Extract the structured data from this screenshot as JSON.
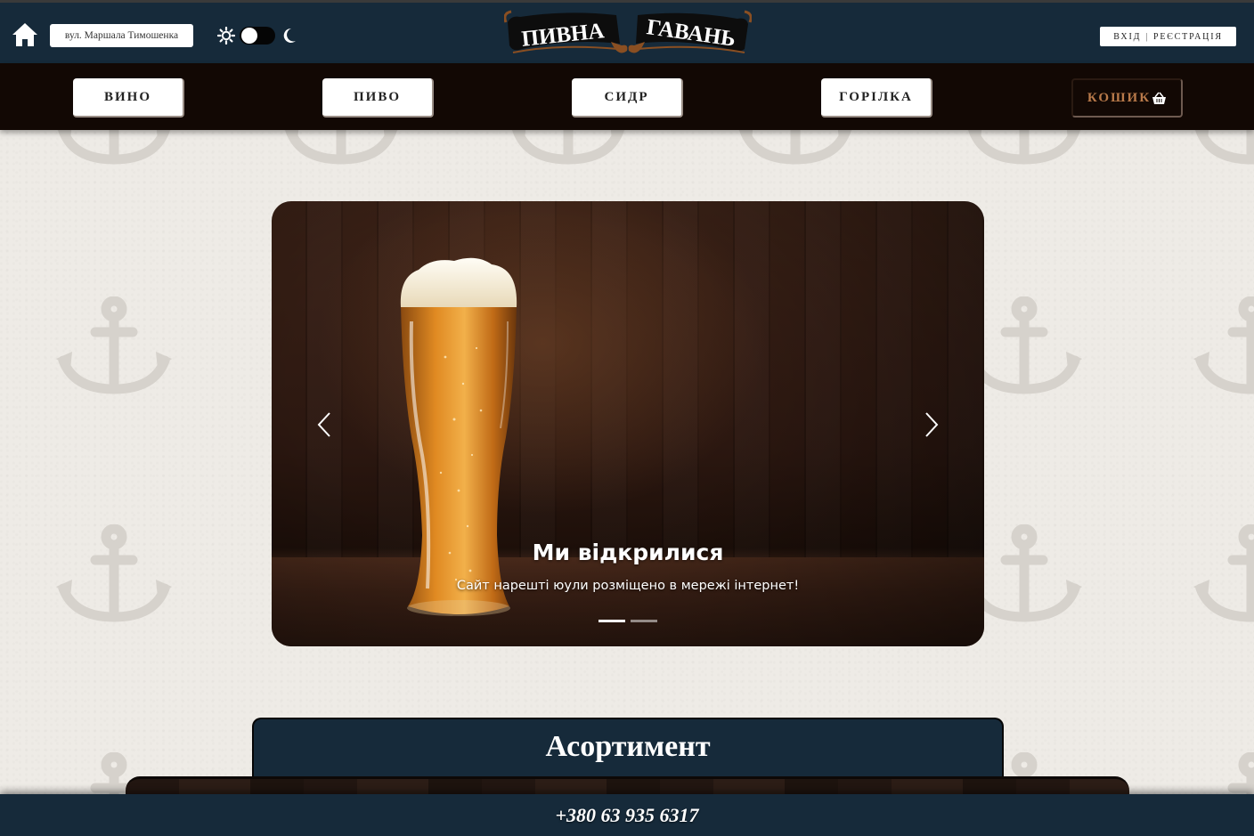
{
  "header": {
    "address": "вул. Маршала Тимошенка",
    "logo": {
      "word1": "ПИВНА",
      "word2": "ГАВАНЬ"
    },
    "auth": {
      "login": "ВХІД",
      "separator": "|",
      "register": "РЕЄСТРАЦІЯ"
    }
  },
  "nav": {
    "items": [
      {
        "label": "ВИНО"
      },
      {
        "label": "ПИВО"
      },
      {
        "label": "СИДР"
      },
      {
        "label": "ГОРІЛКА"
      }
    ],
    "cart_label": "КОШИК"
  },
  "carousel": {
    "title": "Ми відкрилися",
    "text": "Сайт нарешті юули розміщено в мережі інтернет!",
    "slide_count": 2,
    "active_slide": 1
  },
  "assortment": {
    "title": "Асортимент"
  },
  "footer": {
    "phone": "+380 63 935 6317"
  },
  "colors": {
    "header_bg": "#162a3a",
    "nav_bg": "#120804",
    "cart_accent": "#b97a4a",
    "page_bg": "#eeebe6"
  },
  "icons": [
    "home-icon",
    "sun-icon",
    "moon-icon",
    "basket-icon",
    "chevron-left-icon",
    "chevron-right-icon",
    "anchor-icon"
  ]
}
